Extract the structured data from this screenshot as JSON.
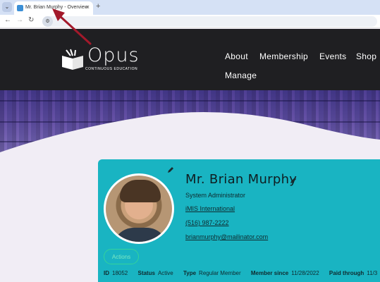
{
  "browser": {
    "tab_title": "Mr. Brian Murphy - Overview",
    "close_glyph": "×",
    "new_tab_glyph": "+",
    "menu_glyph": "⌄",
    "back_glyph": "←",
    "forward_glyph": "→",
    "reload_glyph": "↻",
    "site_info_glyph": "⚙"
  },
  "site": {
    "logo_text": "Opus",
    "logo_subtext": "CONTINUOUS EDUCATION",
    "nav": [
      "About",
      "Membership",
      "Events",
      "Shop",
      "Manage"
    ]
  },
  "profile": {
    "name": "Mr. Brian Murphy",
    "role": "System Administrator",
    "organization": "iMIS International",
    "phone": "(516) 987-2222",
    "email": "brianmurphy@mailinator.com",
    "action_label": "Actions",
    "meta": {
      "id_label": "ID",
      "id_value": "18052",
      "status_label": "Status",
      "status_value": "Active",
      "type_label": "Type",
      "type_value": "Regular Member",
      "member_since_label": "Member since",
      "member_since_value": "11/28/2022",
      "paid_through_label": "Paid through",
      "paid_through_value": "11/3"
    }
  },
  "colors": {
    "card": "#19b4c2",
    "header": "#1f1f22",
    "annotation_arrow": "#a3192b"
  }
}
